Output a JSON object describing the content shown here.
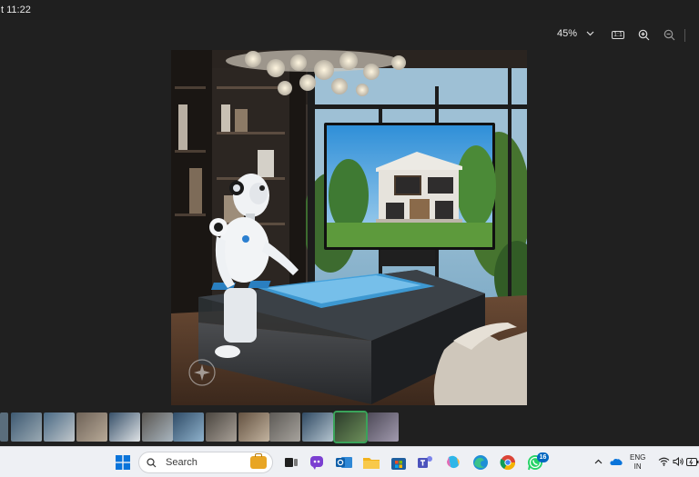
{
  "titlebar": {
    "time_text": "t 11:22"
  },
  "toolbar": {
    "zoom_label": "45%",
    "actual_size_label": "1:1"
  },
  "photo": {
    "alt": "AI-generated image of a white humanoid robot beside a glass table with holographic blueprints, a large screen showing a modern house in the background"
  },
  "filmstrip": {
    "thumb_count": 14,
    "selected_index": 11
  },
  "taskbar": {
    "search_placeholder": "Search",
    "notification_badge": "16",
    "language_line1": "ENG",
    "language_line2": "IN",
    "apps": [
      "windows-start",
      "search",
      "briefcase-widget",
      "task-view",
      "copilot",
      "outlook",
      "file-explorer",
      "microsoft-store",
      "teams",
      "copilot-app",
      "edge",
      "chrome",
      "whatsapp"
    ]
  },
  "colors": {
    "titlebar_bg": "#1f1f1f",
    "viewer_bg": "#202020",
    "taskbar_bg": "#eef0f4",
    "selected_thumb": "#3aa35a",
    "badge": "#0067c0"
  }
}
